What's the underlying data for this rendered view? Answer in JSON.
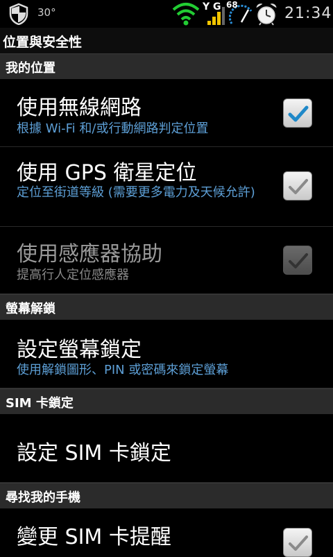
{
  "status_bar": {
    "temperature": "30°",
    "network_label": "Y G",
    "gauge_label": "68",
    "time": "21:34",
    "icons": [
      "shield-icon",
      "wifi-icon",
      "signal-icon",
      "speed-gauge-icon",
      "alarm-clock-icon"
    ]
  },
  "page_title": "位置與安全性",
  "sections": {
    "my_location": "我的位置",
    "screen_unlock": "螢幕解鎖",
    "sim_lock": "SIM 卡鎖定",
    "find_phone": "尋找我的手機"
  },
  "items": {
    "wireless": {
      "title": "使用無線網路",
      "summary": "根據 Wi-Fi 和/或行動網路判定位置",
      "checked": true
    },
    "gps": {
      "title": "使用 GPS 衛星定位",
      "summary": "定位至街道等級 (需要更多電力及天候允許)",
      "checked": true
    },
    "sensor": {
      "title": "使用感應器協助",
      "summary": "提高行人定位感應器",
      "checked": true,
      "enabled": false
    },
    "screen_lock": {
      "title": "設定螢幕鎖定",
      "summary": "使用解鎖圖形、PIN 或密碼來鎖定螢幕"
    },
    "sim_lock": {
      "title": "設定 SIM 卡鎖定"
    },
    "sim_alert": {
      "title": "變更 SIM 卡提醒",
      "checked": true
    }
  },
  "colors": {
    "summary_text": "#5d9fd6",
    "checkmark_active": "#1e88c8",
    "section_bg": "#2b2b2b"
  }
}
